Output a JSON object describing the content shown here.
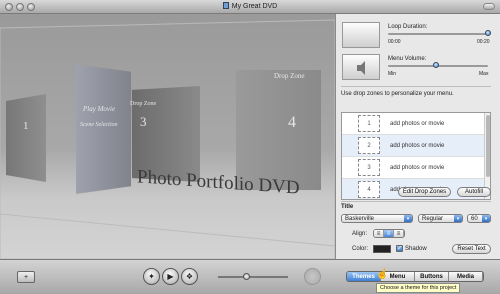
{
  "window": {
    "title": "My Great DVD"
  },
  "preview": {
    "zones": [
      {
        "number": "1"
      },
      {
        "label1": "Play Movie",
        "label2": "Scene Selection"
      },
      {
        "label": "Drop Zone",
        "number": "3"
      },
      {
        "label": "Drop Zone",
        "number": "4"
      }
    ],
    "menu_title": "Photo Portfolio DVD"
  },
  "inspector": {
    "loop_duration_label": "Loop Duration:",
    "loop_start": "00:00",
    "loop_end": "00:20",
    "loop_value_fraction": 1.0,
    "menu_volume_label": "Menu Volume:",
    "volume_min": "Min",
    "volume_max": "Max",
    "volume_fraction": 0.45,
    "drop_instructions": "Use drop zones to personalize your menu.",
    "drop_rows": [
      {
        "number": "1",
        "text": "add photos or movie"
      },
      {
        "number": "2",
        "text": "add photos or movie"
      },
      {
        "number": "3",
        "text": "add photos or movie"
      },
      {
        "number": "4",
        "text": "add photos or movie"
      }
    ],
    "edit_drop_zones_label": "Edit Drop Zones",
    "autofill_label": "Autofill",
    "title_section_label": "Title",
    "font_name": "Baskerville",
    "font_style": "Regular",
    "font_size": "60",
    "align_label": "Align:",
    "color_label": "Color:",
    "shadow_label": "Shadow",
    "shadow_checked": true,
    "reset_text_label": "Reset Text"
  },
  "bottom": {
    "add_label": "+",
    "tabs": [
      "Themes",
      "Menu",
      "Buttons",
      "Media"
    ],
    "selected_tab": "Themes",
    "tooltip": "Choose a theme for this project"
  },
  "colors": {
    "accent": "#3a7bd5",
    "tooltip_bg": "#ffffc7"
  }
}
